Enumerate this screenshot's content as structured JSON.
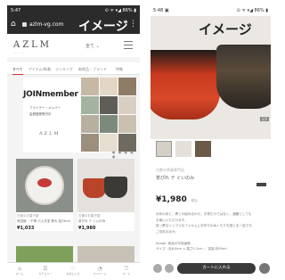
{
  "left_phone": {
    "status": {
      "time": "5:47",
      "signal": "⊙ ᯤ ▾◢ 86% ▮"
    },
    "browser": {
      "home_glyph": "⌂",
      "url": "azlm-vg.com",
      "overlay_title": "イメージ",
      "menu_glyph": "⋮"
    },
    "brand": {
      "logo": "AZLM",
      "logo_sub": "— · · —",
      "category": "全て ⌄"
    },
    "tabs": [
      "すべて",
      "アイテム/新着",
      "ランキング",
      "新商品・ブランド",
      "特集"
    ],
    "banner": {
      "headline": "JOINmember",
      "line1": "フライデー・メンバー",
      "line2": "会員登録受付中",
      "mini_logo": "AZLM"
    },
    "carousel_dots": "● ● ● ● ●",
    "products": [
      {
        "shop": "古都のお菓子屋",
        "name": "有田焼 ・千草 パスタ皿 等大 径23cm",
        "price": "¥1,033"
      },
      {
        "shop": "古都のお菓子屋",
        "name": "茶ぴれ テ ぐいのみ",
        "price": "¥1,980"
      }
    ],
    "bottom_nav": [
      {
        "icon": "⌂",
        "label": "ホーム"
      },
      {
        "icon": "☰",
        "label": "カテゴリー"
      },
      {
        "icon": "♡",
        "label": "お気に入り"
      },
      {
        "icon": "◔",
        "label": "マイページ"
      },
      {
        "icon": "⛉",
        "label": "カート"
      }
    ]
  },
  "right_phone": {
    "status": {
      "time": "5:48 ▣",
      "signal": "⊙ ᯤ ▾◢ 86% ▮"
    },
    "hero_title": "イメージ",
    "image_counter": "1/3",
    "product": {
      "shop": "古都の茶器専門店",
      "name": "茶ぴれ テ ぐいのみ",
      "price": "¥1,980",
      "tax": "税込",
      "desc": [
        "渋めの赤と、黒との組み合わせ。お茶だけではなく、酒器としても",
        "お使いいただけます。",
        "真っ黒なシンプルなフォルムに手作りのぬくもりを感じる一品です。",
        "ご自宅のほか、",
        "",
        "Image: 商品の写真画像",
        "サイズ : 径6.8cm × 高さ5.2cm ／ 容量 約90ml"
      ]
    },
    "cart_button": "カートに入れる"
  }
}
